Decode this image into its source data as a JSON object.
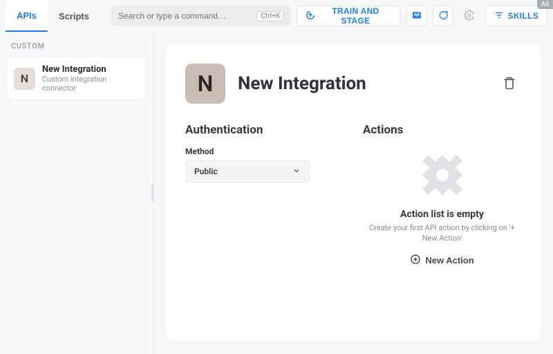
{
  "badge": "All",
  "tabs": {
    "apis": "APIs",
    "scripts": "Scripts"
  },
  "search": {
    "placeholder": "Search or type a command…",
    "shortcut": "Ctrl+K"
  },
  "toolbar": {
    "train_stage": "TRAIN AND STAGE",
    "skills": "SKILLS"
  },
  "sidebar": {
    "section": "CUSTOM",
    "item": {
      "initial": "N",
      "title": "New Integration",
      "subtitle": "Custom integration connector"
    }
  },
  "panel": {
    "initial": "N",
    "title": "New Integration",
    "auth": {
      "heading": "Authentication",
      "method_label": "Method",
      "method_value": "Public"
    },
    "actions": {
      "heading": "Actions",
      "empty_title": "Action list is empty",
      "empty_desc": "Create your first API action by clicking on '+ New Action'",
      "new_action": "New Action"
    }
  }
}
